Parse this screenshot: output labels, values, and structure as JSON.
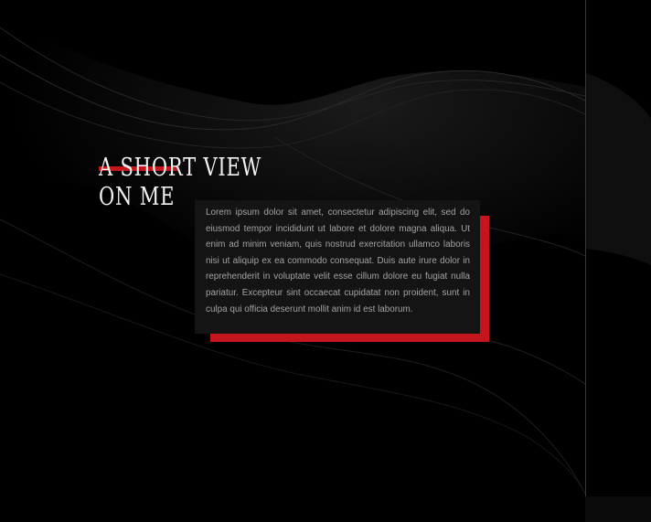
{
  "section": {
    "title_line_1": "A SHORT VIEW",
    "title_line_2": "ON ME"
  },
  "about": {
    "body": "Lorem ipsum dolor sit amet, consectetur adipiscing elit, sed do eiusmod tempor incididunt ut labore et dolore magna aliqua. Ut enim ad minim veniam, quis nostrud exercitation ullamco laboris nisi ut aliquip ex ea commodo consequat. Duis aute irure dolor in reprehenderit in voluptate velit esse cillum dolore eu fugiat nulla pariatur. Excepteur sint occaecat cupidatat non proident, sunt in culpa qui officia deserunt mollit anim id est laborum."
  },
  "colors": {
    "background": "#000000",
    "accent": "#c4161c",
    "card": "#141414",
    "body_text": "#a3a3a3",
    "title_text": "#f2f2f2"
  }
}
